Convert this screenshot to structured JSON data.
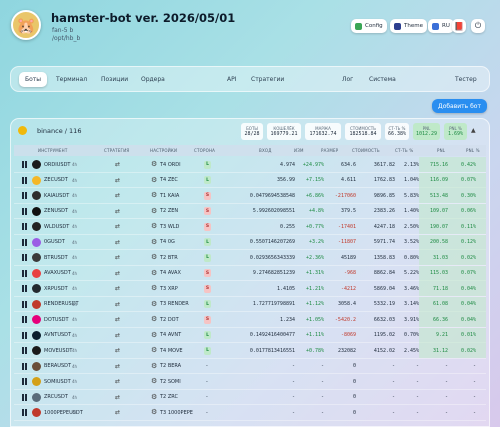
{
  "app": {
    "logo_icon": "hamster-logo-icon",
    "title": "hamster-bot ver. 2026/05/01",
    "subtitle": "fan-5 b",
    "path": "/opt/hb_b"
  },
  "header_buttons": {
    "config": "Config",
    "theme": "Theme",
    "lang": "RU"
  },
  "tabs": [
    "Боты",
    "Терминал",
    "Позиции",
    "Ордера",
    "API",
    "Стратегии",
    "Лог",
    "Система",
    "Тестер"
  ],
  "add_bot": "Добавить бот",
  "exchange": {
    "name": "binance / 116",
    "stats": [
      {
        "label": "БОТЫ",
        "value": "28/28"
      },
      {
        "label": "КОШЕЛЁК",
        "value": "169779.21"
      },
      {
        "label": "МАРЖА",
        "value": "171632.74"
      },
      {
        "label": "СТОИМОСТЬ",
        "value": "182518.84"
      },
      {
        "label": "СТ-ТЬ %",
        "value": "66.38%"
      },
      {
        "label": "PNL",
        "value": "1012.29"
      },
      {
        "label": "PNL %",
        "value": "1.69%"
      }
    ],
    "collapse": "▲"
  },
  "columns": [
    "ИНСТРУМЕНТ",
    "СТРАТЕГИЯ",
    "НАСТРОЙКИ",
    "СТОРОНА",
    "ВХОД",
    "ИЗМ",
    "РАЗМЕР",
    "СТОИМОСТЬ",
    "СТ-ТЬ %",
    "PNL",
    "PNL %"
  ],
  "rows": [
    {
      "symbol": "ORDIUSDT",
      "tf": "4h",
      "setting": "T4 ORDI",
      "side": "L",
      "entry": "4.974",
      "change": "+24.97%",
      "size": "634.6",
      "value": "3617.82",
      "value_pct": "2.13%",
      "pnl": "715.16",
      "pnl_pct": "0.42%",
      "color": "#1b1b1b"
    },
    {
      "symbol": "ZECUSDT",
      "tf": "4h",
      "setting": "T4 ZEC",
      "side": "L",
      "entry": "356.99",
      "change": "+7.15%",
      "size": "4.611",
      "value": "1762.83",
      "value_pct": "1.04%",
      "pnl": "116.09",
      "pnl_pct": "0.07%",
      "color": "#f4b728"
    },
    {
      "symbol": "KAIAUSDT",
      "tf": "4h",
      "setting": "T1 KAIA",
      "side": "S",
      "entry": "0.0479694538548",
      "change": "+6.86%",
      "size": "-217060",
      "value": "9896.85",
      "value_pct": "5.83%",
      "pnl": "513.48",
      "pnl_pct": "0.30%",
      "color": "#2d2d2d"
    },
    {
      "symbol": "ZENUSDT",
      "tf": "4h",
      "setting": "T2 ZEN",
      "side": "S",
      "entry": "5.992602098551",
      "change": "+4.8%",
      "size": "379.5",
      "value": "2383.26",
      "value_pct": "1.40%",
      "pnl": "109.07",
      "pnl_pct": "0.06%",
      "color": "#111111"
    },
    {
      "symbol": "WLDUSDT",
      "tf": "4h",
      "setting": "T3 WLD",
      "side": "S",
      "entry": "0.255",
      "change": "+0.77%",
      "size": "-17401",
      "value": "4247.18",
      "value_pct": "2.50%",
      "pnl": "190.07",
      "pnl_pct": "0.11%",
      "color": "#222222"
    },
    {
      "symbol": "0GUSDT",
      "tf": "4h",
      "setting": "T4 0G",
      "side": "L",
      "entry": "0.5507146207269",
      "change": "+3.2%",
      "size": "-11807",
      "value": "5971.74",
      "value_pct": "3.52%",
      "pnl": "200.58",
      "pnl_pct": "0.12%",
      "color": "#9b5de5"
    },
    {
      "symbol": "BTRUSDT",
      "tf": "4h",
      "setting": "T2 BTR",
      "side": "L",
      "entry": "0.0293656343339",
      "change": "+2.36%",
      "size": "45189",
      "value": "1358.83",
      "value_pct": "0.80%",
      "pnl": "31.03",
      "pnl_pct": "0.02%",
      "color": "#3a3a3a"
    },
    {
      "symbol": "AVAXUSDT",
      "tf": "4h",
      "setting": "T4 AVAX",
      "side": "S",
      "entry": "9.274682851239",
      "change": "+1.31%",
      "size": "-968",
      "value": "8862.84",
      "value_pct": "5.22%",
      "pnl": "115.03",
      "pnl_pct": "0.07%",
      "color": "#e84142"
    },
    {
      "symbol": "XRPUSDT",
      "tf": "4h",
      "setting": "T3 XRP",
      "side": "S",
      "entry": "1.4105",
      "change": "+1.21%",
      "size": "-4212",
      "value": "5869.04",
      "value_pct": "3.46%",
      "pnl": "71.18",
      "pnl_pct": "0.04%",
      "color": "#23292f"
    },
    {
      "symbol": "RENDERUSDT",
      "tf": "4h",
      "setting": "T3 RENDER",
      "side": "L",
      "entry": "1.727719798891",
      "change": "+1.12%",
      "size": "3058.4",
      "value": "5332.19",
      "value_pct": "3.14%",
      "pnl": "61.08",
      "pnl_pct": "0.04%",
      "color": "#c0392b"
    },
    {
      "symbol": "DOTUSDT",
      "tf": "4h",
      "setting": "T2 DOT",
      "side": "S",
      "entry": "1.234",
      "change": "+1.05%",
      "size": "-5420.2",
      "value": "6632.03",
      "value_pct": "3.91%",
      "pnl": "66.36",
      "pnl_pct": "0.04%",
      "color": "#e6007a"
    },
    {
      "symbol": "AVNTUSDT",
      "tf": "4h",
      "setting": "T4 AVNT",
      "side": "L",
      "entry": "0.1492416400477",
      "change": "+1.11%",
      "size": "-8069",
      "value": "1195.02",
      "value_pct": "0.70%",
      "pnl": "9.21",
      "pnl_pct": "0.01%",
      "color": "#0b1e2e"
    },
    {
      "symbol": "MOVEUSDT",
      "tf": "4h",
      "setting": "T4 MOVE",
      "side": "L",
      "entry": "0.0177813416551",
      "change": "+0.78%",
      "size": "232082",
      "value": "4152.02",
      "value_pct": "2.45%",
      "pnl": "31.12",
      "pnl_pct": "0.02%",
      "color": "#1a1a1a"
    },
    {
      "symbol": "BERAUSDT",
      "tf": "4h",
      "setting": "T2 BERA",
      "side": "-",
      "entry": "-",
      "change": "-",
      "size": "0",
      "value": "-",
      "value_pct": "-",
      "pnl": "-",
      "pnl_pct": "-",
      "color": "#6b4f3a"
    },
    {
      "symbol": "SOMIUSDT",
      "tf": "4h",
      "setting": "T2 SOMI",
      "side": "-",
      "entry": "-",
      "change": "-",
      "size": "0",
      "value": "-",
      "value_pct": "-",
      "pnl": "-",
      "pnl_pct": "-",
      "color": "#d4a017"
    },
    {
      "symbol": "ZRCUSDT",
      "tf": "4h",
      "setting": "T2 ZRC",
      "side": "-",
      "entry": "-",
      "change": "-",
      "size": "0",
      "value": "-",
      "value_pct": "-",
      "pnl": "-",
      "pnl_pct": "-",
      "color": "#5a6b7a"
    },
    {
      "symbol": "1000PEPEUSDT",
      "tf": "4h",
      "setting": "T3 1000PEPE",
      "side": "-",
      "entry": "-",
      "change": "-",
      "size": "0",
      "value": "-",
      "value_pct": "-",
      "pnl": "-",
      "pnl_pct": "-",
      "color": "#c0392b"
    }
  ]
}
